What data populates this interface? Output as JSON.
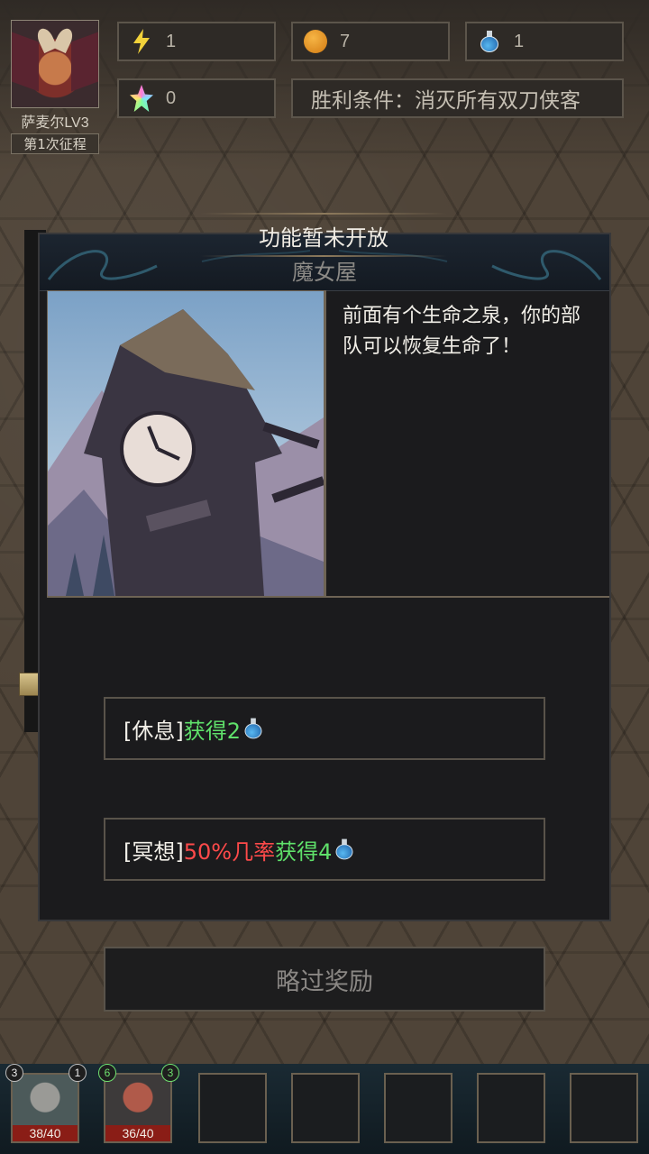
{
  "hero": {
    "name": "萨麦尔LV3",
    "campaign": "第1次征程"
  },
  "stats": {
    "energy": "1",
    "gold": "7",
    "potion": "1",
    "gem": "0",
    "victory_condition": "胜利条件：消灭所有双刀侠客"
  },
  "notice": "功能暂未开放",
  "dialog": {
    "title": "魔女屋",
    "description": "前面有个生命之泉，你的部队可以恢复生命了！",
    "options": [
      {
        "tag": "[休息]",
        "gain_text": "获得2"
      },
      {
        "tag": "[冥想]",
        "chance_text": "50%几率",
        "gain_text": "获得4"
      }
    ],
    "skip_label": "略过奖励"
  },
  "units": [
    {
      "hp": "38/40",
      "badge_left": "3",
      "badge_right": "1"
    },
    {
      "hp": "36/40",
      "badge_left": "6",
      "badge_right": "3"
    }
  ],
  "icons": {
    "energy": "lightning-icon",
    "gold": "coin-icon",
    "potion": "potion-icon",
    "gem": "gem-icon"
  },
  "colors": {
    "green": "#5fe06a",
    "red": "#ff4a4a",
    "hp_bar": "#8a1d16"
  }
}
